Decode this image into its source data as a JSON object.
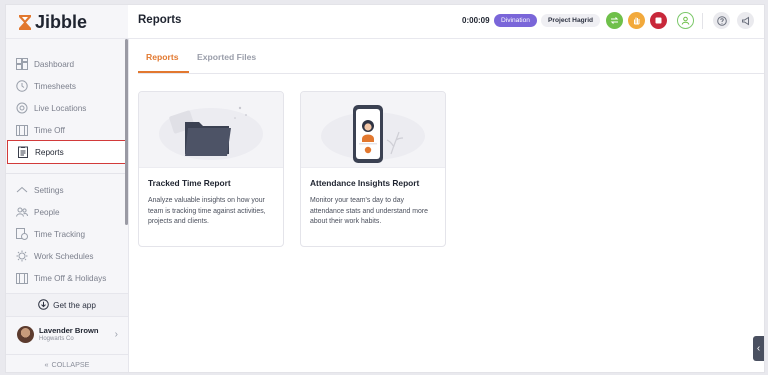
{
  "app": {
    "name": "Jibble"
  },
  "header": {
    "title": "Reports",
    "timer": "0:00:09",
    "activity_badge": "Divination",
    "project_badge": "Project Hagrid"
  },
  "sidebar": {
    "items": [
      {
        "label": "Dashboard",
        "icon": "dashboard-icon"
      },
      {
        "label": "Timesheets",
        "icon": "clock-icon"
      },
      {
        "label": "Live Locations",
        "icon": "location-icon"
      },
      {
        "label": "Time Off",
        "icon": "calendar-icon"
      },
      {
        "label": "Reports",
        "icon": "report-icon",
        "active": true
      },
      {
        "label": "Settings",
        "icon": "chevron-up-icon"
      },
      {
        "label": "People",
        "icon": "people-icon"
      },
      {
        "label": "Time Tracking",
        "icon": "time-tracking-icon"
      },
      {
        "label": "Work Schedules",
        "icon": "schedule-icon"
      },
      {
        "label": "Time Off & Holidays",
        "icon": "holiday-icon"
      }
    ],
    "get_app": "Get the app",
    "user": {
      "name": "Lavender Brown",
      "org": "Hogwarts Co"
    },
    "collapse": "COLLAPSE"
  },
  "tabs": [
    {
      "label": "Reports",
      "active": true
    },
    {
      "label": "Exported Files",
      "active": false
    }
  ],
  "cards": [
    {
      "title": "Tracked Time Report",
      "description": "Analyze valuable insights on how your team is tracking time against activities, projects and clients."
    },
    {
      "title": "Attendance Insights Report",
      "description": "Monitor your team's day to day attendance stats and understand more about their work habits."
    }
  ],
  "colors": {
    "accent": "#e2782f",
    "active_border": "#d23a3a",
    "badge_purple": "#7a66d9",
    "switch_green": "#6fc04a",
    "break_orange": "#f2a93b",
    "stop_red": "#c8283a"
  }
}
